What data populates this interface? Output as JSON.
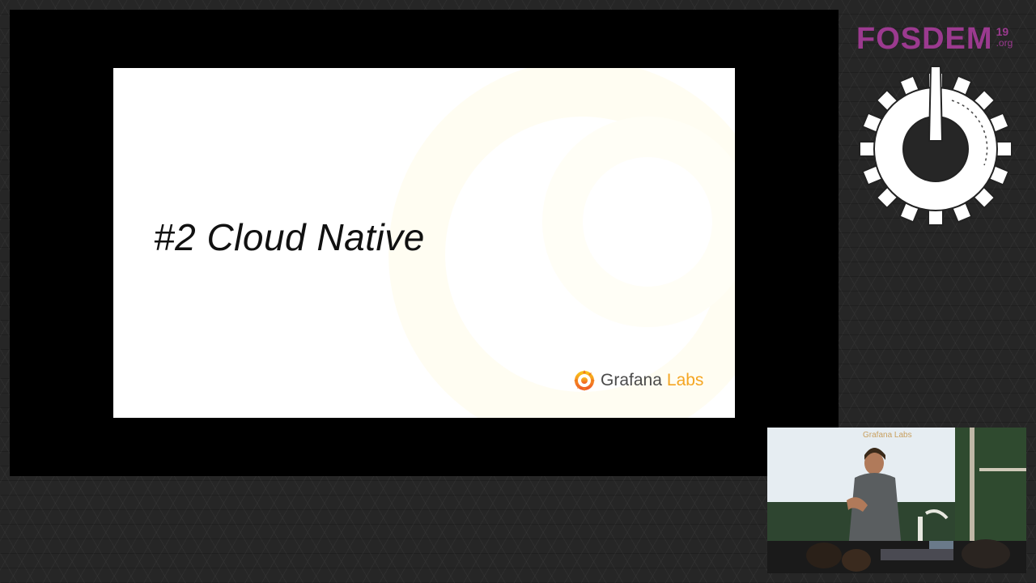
{
  "slide": {
    "title": "#2 Cloud Native",
    "brand": {
      "name": "Grafana",
      "suffix": "Labs",
      "icon": "grafana-swirl-icon"
    }
  },
  "conference": {
    "name": "FOSDEM",
    "year": "19",
    "tld": ".org",
    "icon": "fosdem-gear-icon",
    "accent_color": "#9b3a8f"
  },
  "camera": {
    "projected_brand": "Grafana Labs"
  }
}
